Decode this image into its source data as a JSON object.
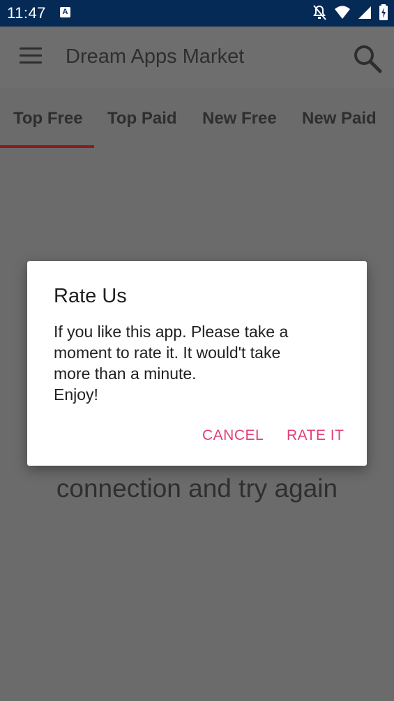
{
  "status_bar": {
    "time": "11:47",
    "app_icon_letter": "A",
    "icons": [
      "notifications-off-icon",
      "wifi-icon",
      "signal-icon",
      "battery-icon"
    ]
  },
  "app_bar": {
    "title": "Dream Apps Market",
    "menu_icon": "menu-icon",
    "search_icon": "search-icon"
  },
  "tabs": [
    {
      "label": "Top Free",
      "selected": true
    },
    {
      "label": "Top Paid",
      "selected": false
    },
    {
      "label": "New Free",
      "selected": false
    },
    {
      "label": "New Paid",
      "selected": false
    }
  ],
  "background_message": {
    "visible_text": "connection and try again"
  },
  "dialog": {
    "title": "Rate Us",
    "body": "If you like this app. Please take a\nmoment to rate it. It would't take\nmore than a minute.\nEnjoy!",
    "cancel_label": "CANCEL",
    "rate_label": "RATE IT"
  },
  "colors": {
    "status_bar": "#042a55",
    "accent": "#e23f7a",
    "tab_indicator": "#8a1c1c",
    "scrim_background": "#6b6b6b"
  }
}
